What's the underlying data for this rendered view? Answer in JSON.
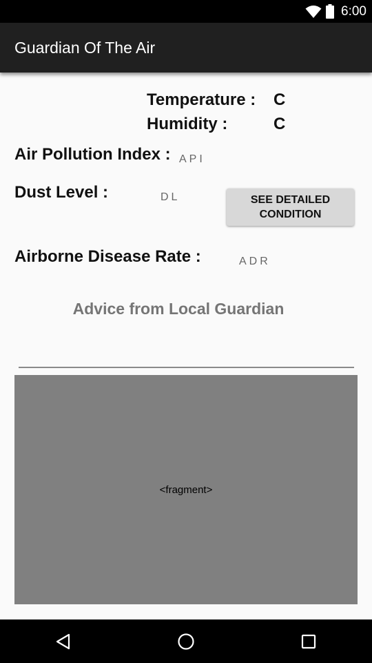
{
  "status_bar": {
    "time": "6:00"
  },
  "app_bar": {
    "title": "Guardian Of The Air"
  },
  "conditions": {
    "temperature_label": "Temperature :",
    "temperature_unit": "C",
    "humidity_label": "Humidity :",
    "humidity_unit": "C",
    "api_label": "Air Pollution Index :",
    "api_value": "API",
    "dust_label": "Dust Level :",
    "dust_value": "DL",
    "detail_button_label": "SEE DETAILED CONDITION",
    "disease_label": "Airborne Disease Rate :",
    "disease_value": "ADR"
  },
  "advice": {
    "title": "Advice from Local Guardian"
  },
  "fragment": {
    "label": "<fragment>"
  },
  "nav_bar": {
    "back_icon": "back-triangle",
    "home_icon": "home-circle",
    "recents_icon": "recents-square"
  }
}
